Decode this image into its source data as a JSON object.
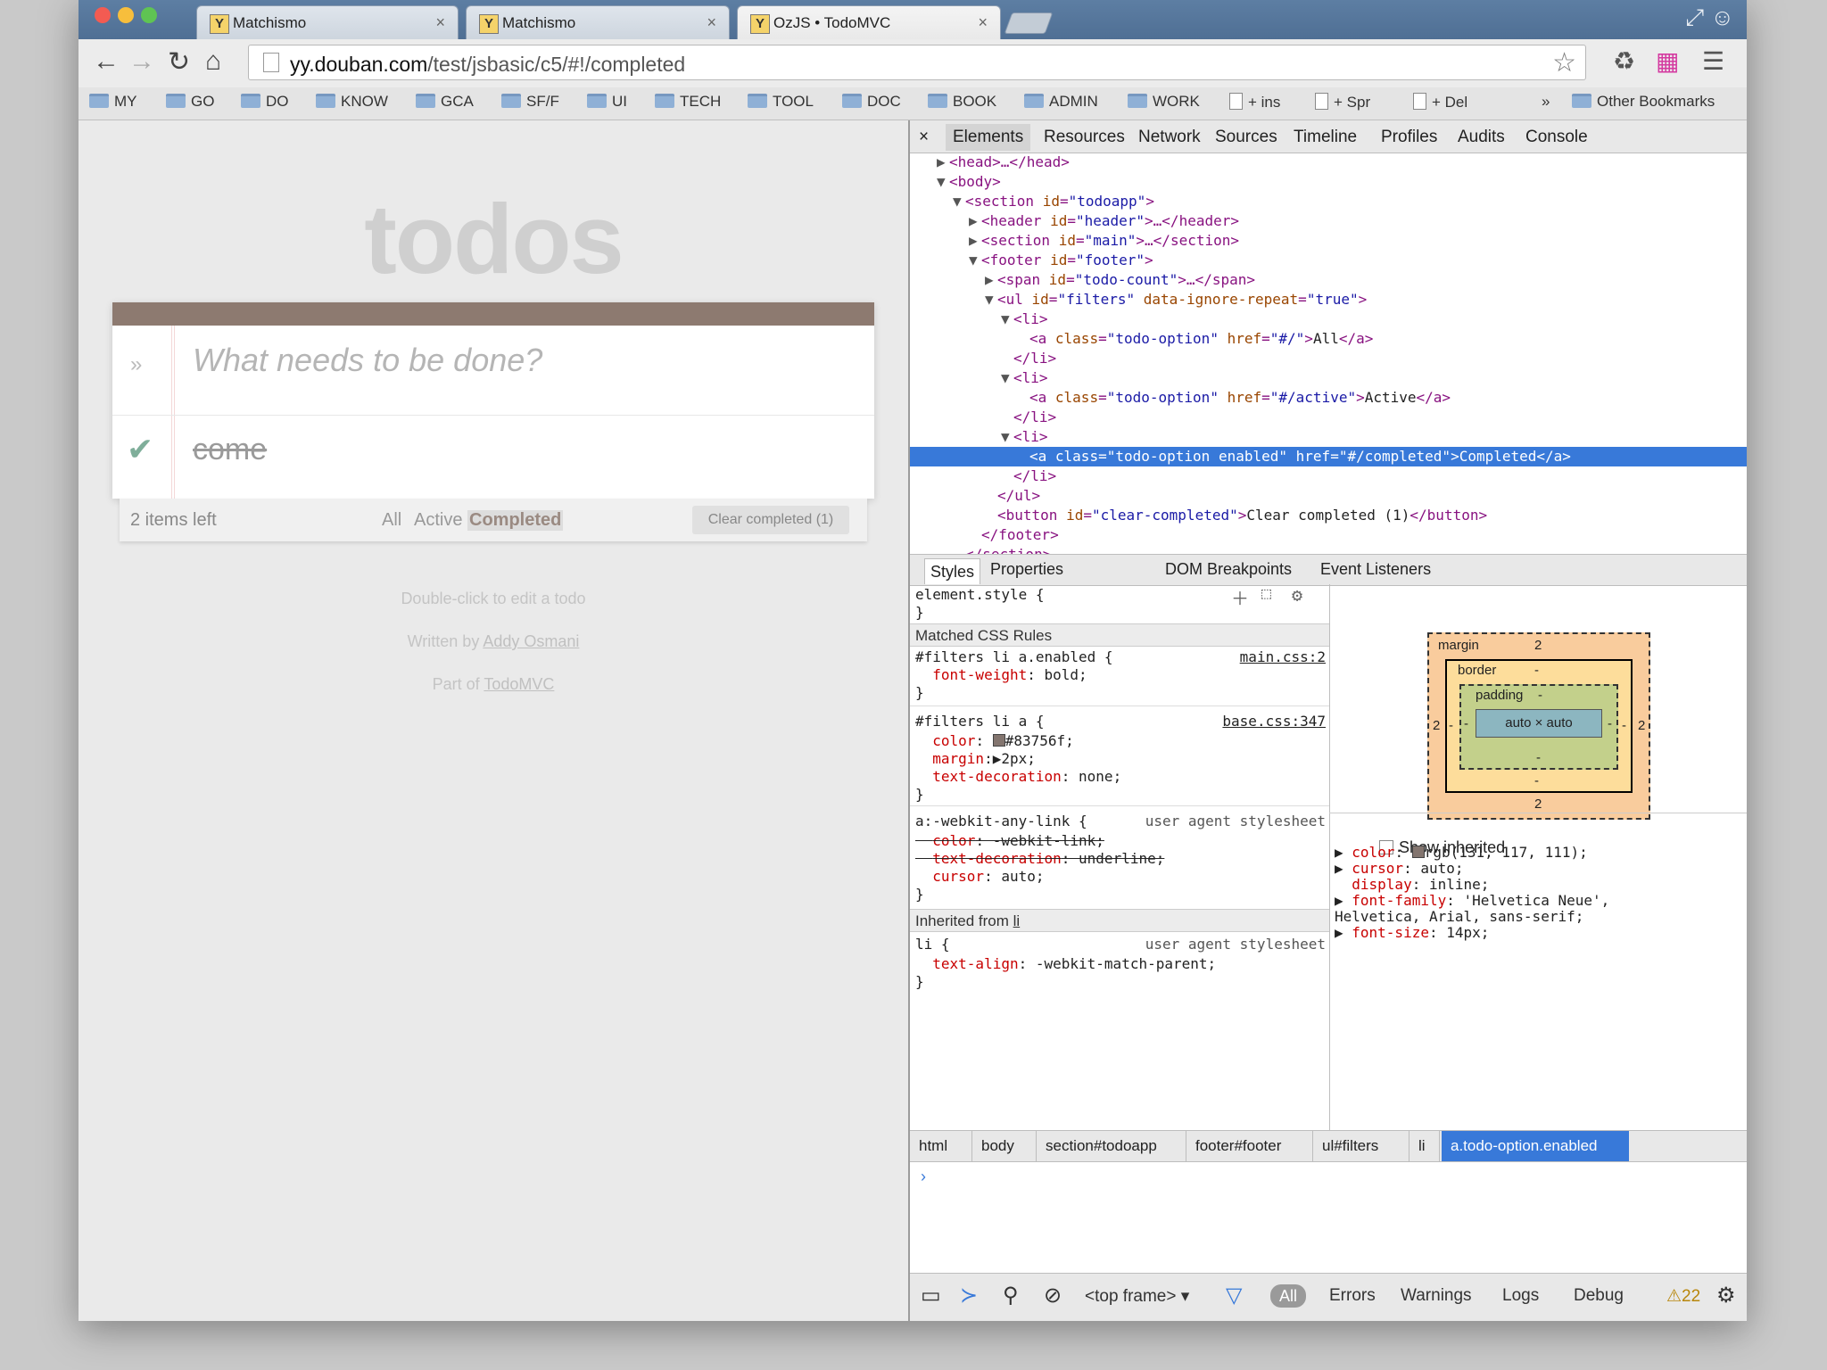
{
  "browser": {
    "tabs": [
      {
        "favicon": "Y",
        "title": "Matchismo"
      },
      {
        "favicon": "Y",
        "title": "Matchismo"
      },
      {
        "favicon": "Y",
        "title": "OzJS • TodoMVC"
      }
    ],
    "tab_close": "×",
    "url_host": "yy.douban.com",
    "url_path": "/test/jsbasic/c5/#!/completed",
    "bookmarks": [
      "MY",
      "GO",
      "DO",
      "KNOW",
      "GCA",
      "SF/F",
      "UI",
      "TECH",
      "TOOL",
      "DOC",
      "BOOK",
      "ADMIN",
      "WORK"
    ],
    "bookmark_pages": [
      "+ ins",
      "+ Spr",
      "+ Del"
    ],
    "bookmarks_more": "»",
    "other_bookmarks": "Other Bookmarks"
  },
  "todo": {
    "title": "todos",
    "placeholder": "What needs to be done?",
    "item": "come",
    "items_left": "2 items left",
    "filters": [
      "All",
      "Active",
      "Completed"
    ],
    "clear_completed": "Clear completed (1)",
    "info_edit": "Double-click to edit a todo",
    "written_by_prefix": "Written by ",
    "written_by_link": "Addy Osmani",
    "part_of_prefix": "Part of ",
    "part_of_link": "TodoMVC"
  },
  "devtools": {
    "close": "×",
    "tabs": [
      "Elements",
      "Resources",
      "Network",
      "Sources",
      "Timeline",
      "Profiles",
      "Audits",
      "Console"
    ],
    "sidebar_tabs": [
      "Styles",
      "Properties",
      "DOM Breakpoints",
      "Event Listeners"
    ],
    "matched_header": "Matched CSS Rules",
    "inherited_header_prefix": "Inherited from ",
    "inherited_header_link": "li",
    "show_inherited": "Show inherited",
    "box_model": {
      "margin_label": "margin",
      "margin_top": "2",
      "margin_bottom": "2",
      "margin_left": "2",
      "margin_right": "2",
      "border_label": "border",
      "border_top": "-",
      "border_bottom": "-",
      "border_left": "-",
      "border_right": "-",
      "padding_label": "padding",
      "padding_top": "-",
      "padding_bottom": "-",
      "padding_left": "-",
      "padding_right": "-",
      "content": "auto × auto"
    },
    "breadcrumbs": [
      "html",
      "body",
      "section#todoapp",
      "footer#footer",
      "ul#filters",
      "li",
      "a.todo-option.enabled"
    ],
    "console_prompt": "›",
    "status": {
      "frame": "<top frame> ▾",
      "all": "All",
      "errors": "Errors",
      "warnings": "Warnings",
      "logs": "Logs",
      "debug": "Debug",
      "warn_count": "⚠22"
    }
  }
}
